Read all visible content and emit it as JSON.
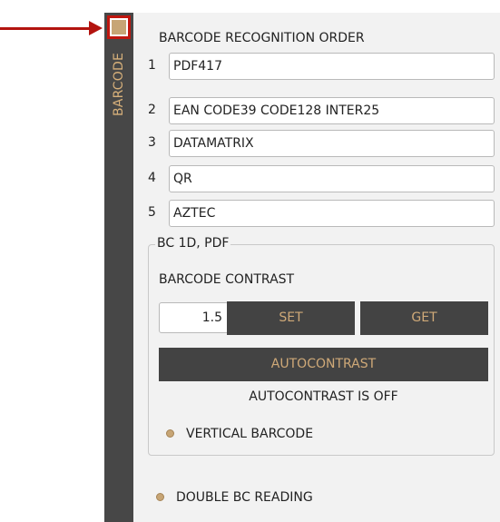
{
  "side_tab": {
    "label": "BARCODE",
    "indicator_color": "#c7a575",
    "highlight_color": "#c0160f"
  },
  "annotation": {
    "arrow_color": "#b3140f"
  },
  "recognition_order": {
    "title": "BARCODE RECOGNITION ORDER",
    "rows": [
      {
        "number": "1",
        "value": "PDF417"
      },
      {
        "number": "2",
        "value": "EAN CODE39 CODE128 INTER25"
      },
      {
        "number": "3",
        "value": "DATAMATRIX"
      },
      {
        "number": "4",
        "value": "QR"
      },
      {
        "number": "5",
        "value": "AZTEC"
      }
    ]
  },
  "bc_group": {
    "title": "BC 1D, PDF",
    "contrast_label": "BARCODE CONTRAST",
    "contrast_value": "1.5",
    "set_label": "SET",
    "get_label": "GET",
    "autocontrast_label": "AUTOCONTRAST",
    "autocontrast_status": "AUTOCONTRAST IS OFF",
    "vertical_barcode_label": "VERTICAL BARCODE"
  },
  "double_reading_label": "DOUBLE BC READING",
  "colors": {
    "dark_button_bg": "#434343",
    "button_text": "#cfa978",
    "panel_bg": "#f2f2f2",
    "strip_bg": "#474747"
  }
}
